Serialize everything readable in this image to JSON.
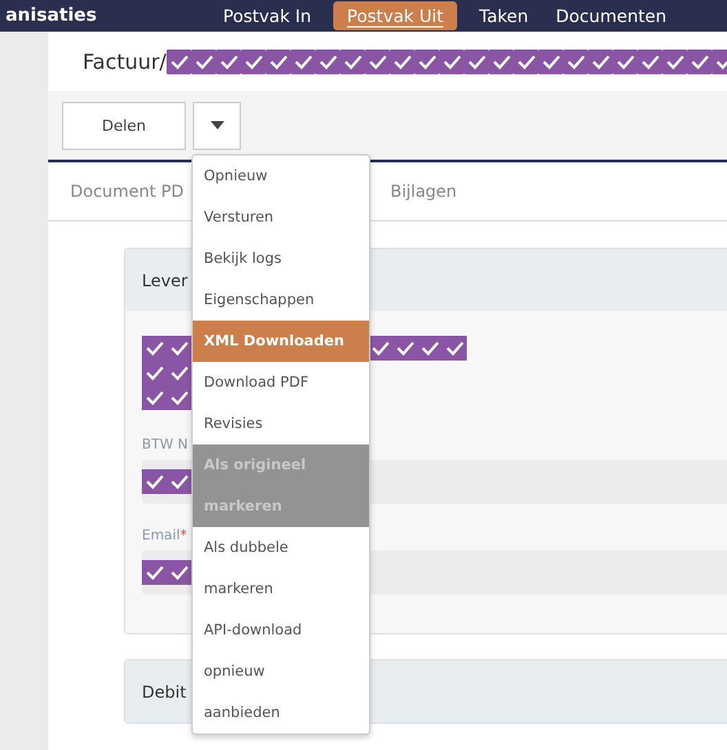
{
  "nav": {
    "brand": "anisaties",
    "tabs": [
      {
        "label": "Postvak In",
        "selected": false
      },
      {
        "label": "Postvak Uit",
        "selected": true
      },
      {
        "label": "Taken",
        "selected": false
      },
      {
        "label": "Documenten",
        "selected": false
      }
    ]
  },
  "page_title": "Factuur/",
  "toolbar": {
    "share_button": "Delen"
  },
  "tabs": [
    {
      "label": "Document PD",
      "selected": false
    },
    {
      "label": "Bijlagen",
      "selected": false
    }
  ],
  "cards": [
    {
      "title": "Lever",
      "fields": [
        {
          "label": "BTW N"
        },
        {
          "label": "Email",
          "required_mark": "*"
        }
      ]
    },
    {
      "title": "Debit"
    }
  ],
  "menu": [
    {
      "label": "Opnieuw",
      "highlighted": false,
      "disabled": false
    },
    {
      "label": "Versturen",
      "highlighted": false,
      "disabled": false
    },
    {
      "label": "Bekijk logs",
      "highlighted": false,
      "disabled": false
    },
    {
      "label": "Eigenschappen",
      "highlighted": false,
      "disabled": false
    },
    {
      "label": "XML Downloaden",
      "highlighted": true,
      "disabled": false
    },
    {
      "label": "Download PDF",
      "highlighted": false,
      "disabled": false
    },
    {
      "label": "Revisies",
      "highlighted": false,
      "disabled": false
    },
    {
      "label": "Als origineel markeren",
      "highlighted": false,
      "disabled": true
    },
    {
      "label": "Als dubbele markeren",
      "highlighted": false,
      "disabled": false
    },
    {
      "label": "API-download opnieuw aanbieden",
      "highlighted": false,
      "disabled": false
    }
  ]
}
